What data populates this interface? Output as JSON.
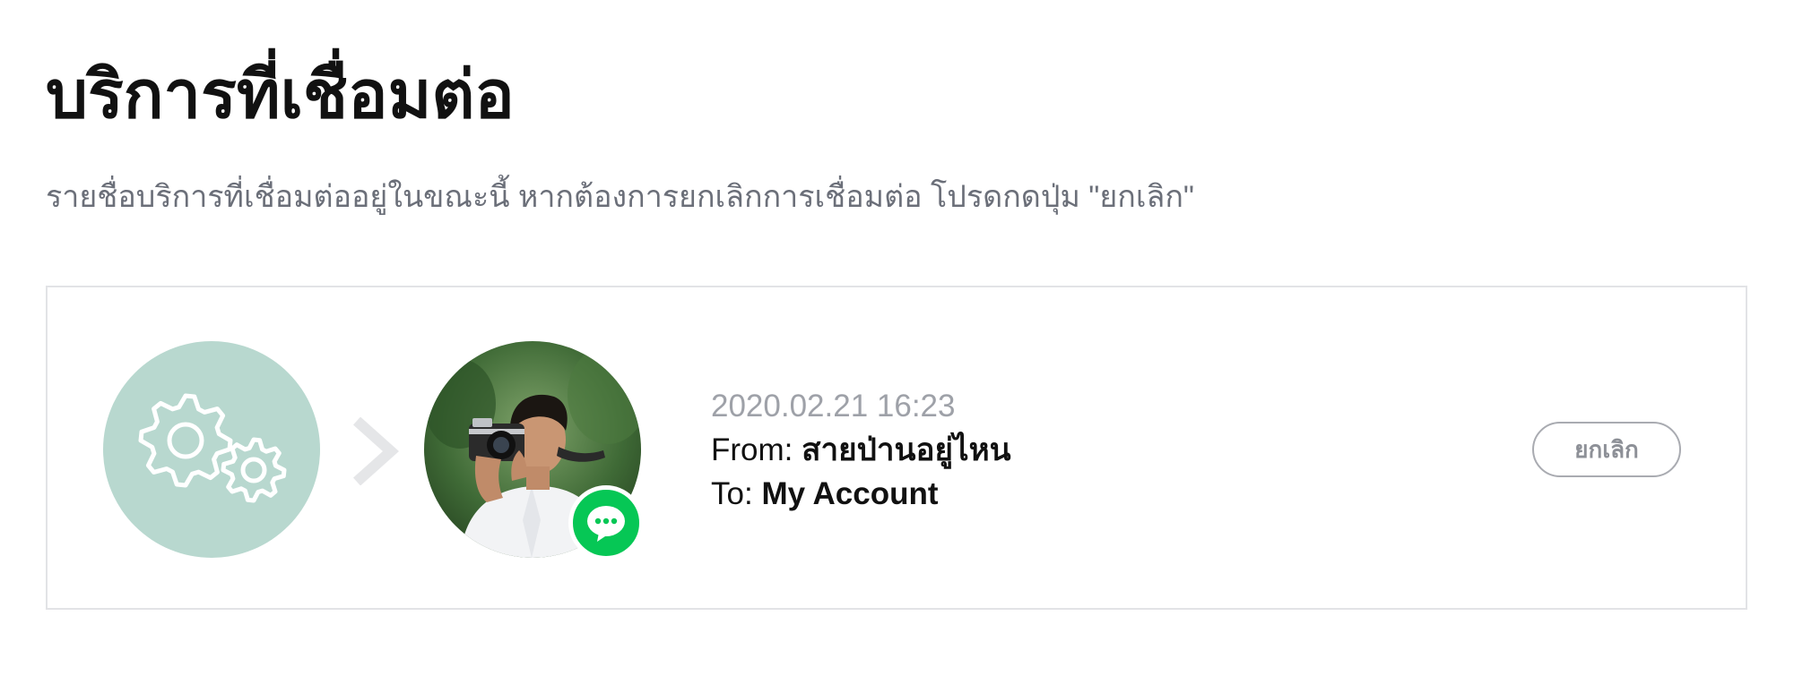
{
  "page": {
    "title": "บริการที่เชื่อมต่อ",
    "description": "รายชื่อบริการที่เชื่อมต่ออยู่ในขณะนี้ หากต้องการยกเลิกการเชื่อมต่อ โปรดกดปุ่ม \"ยกเลิก\""
  },
  "connection": {
    "service_icon": "gears-icon",
    "arrow_icon": "chevron-right-icon",
    "avatar_icon": "profile-photo",
    "badge_icon": "chat-bubble-icon",
    "datetime": "2020.02.21 16:23",
    "from_label": "From:",
    "from_value": "สายป่านอยู่ไหน",
    "to_label": "To:",
    "to_value": "My Account",
    "cancel_label": "ยกเลิก"
  },
  "colors": {
    "service_circle": "#b8d8cf",
    "badge": "#06c755",
    "muted_text": "#6b6f79",
    "date_text": "#9ea1a8",
    "button_border": "#a9abb1"
  }
}
